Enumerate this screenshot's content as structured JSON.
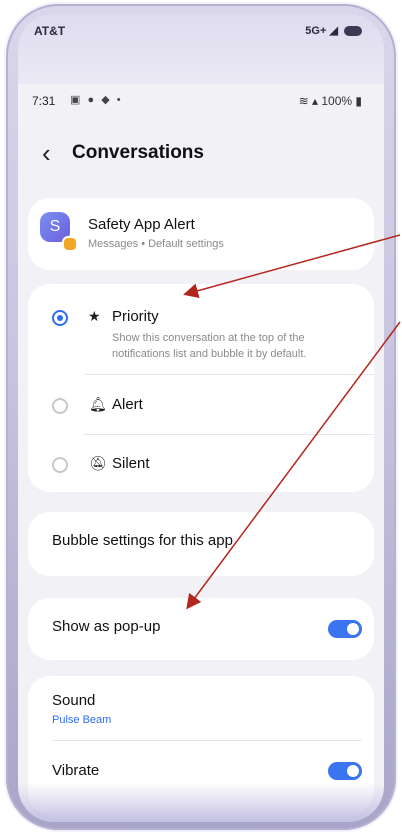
{
  "carrier": "AT&T",
  "carrier_signal": "5G+",
  "status": {
    "time": "7:31",
    "battery": "100%"
  },
  "header": {
    "title": "Conversations"
  },
  "app": {
    "icon_letter": "S",
    "name": "Safety App Alert",
    "subtitle": "Messages • Default settings"
  },
  "modes": [
    {
      "label": "Priority",
      "icon": "star-icon",
      "selected": true,
      "description": "Show this conversation at the top of the notifications list and bubble it by default."
    },
    {
      "label": "Alert",
      "icon": "bell-icon",
      "selected": false
    },
    {
      "label": "Silent",
      "icon": "bell-off-icon",
      "selected": false
    }
  ],
  "bubble_settings": {
    "label": "Bubble settings for this app"
  },
  "popup": {
    "label": "Show as pop-up",
    "on": true
  },
  "sound": {
    "label": "Sound",
    "value": "Pulse Beam"
  },
  "vibrate": {
    "label": "Vibrate",
    "on": true
  },
  "colors": {
    "accent": "#2f6df0",
    "annotation_arrow": "#b3261e",
    "card": "#ffffff",
    "background": "#f2f2f6"
  }
}
